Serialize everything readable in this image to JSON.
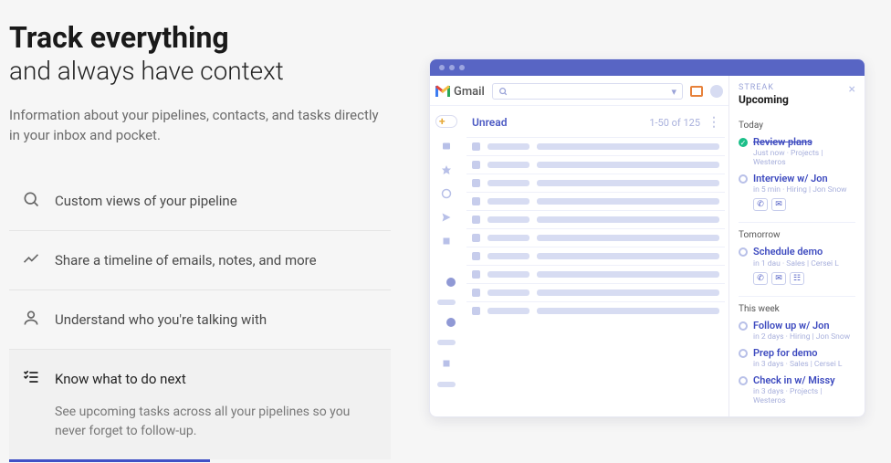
{
  "hero": {
    "title": "Track everything",
    "subtitle": "and always have context",
    "lead": "Information about your pipelines, contacts, and tasks directly in your inbox and pocket."
  },
  "features": [
    {
      "label": "Custom views of your pipeline"
    },
    {
      "label": "Share a timeline of emails, notes, and more"
    },
    {
      "label": "Understand who you're talking with"
    },
    {
      "label": "Know what to do next",
      "desc": "See upcoming tasks across all your pipelines so you never forget to follow-up."
    }
  ],
  "gmail": {
    "brand": "Gmail",
    "inbox_label": "Unread",
    "count": "1-50 of 125"
  },
  "streak": {
    "brand": "STREAK",
    "title": "Upcoming",
    "sections": [
      {
        "label": "Today",
        "tasks": [
          {
            "title": "Review plans",
            "meta": "Just now · Projects | Westeros",
            "done": true
          },
          {
            "title": "Interview w/ Jon",
            "meta": "in 5 min · Hiring | Jon Snow",
            "actions": [
              "phone",
              "mail"
            ]
          }
        ]
      },
      {
        "label": "Tomorrow",
        "tasks": [
          {
            "title": "Schedule demo",
            "meta": "in 1 dau · Sales | Cersei L",
            "actions": [
              "phone",
              "mail",
              "calendar"
            ]
          }
        ]
      },
      {
        "label": "This week",
        "tasks": [
          {
            "title": "Follow up w/ Jon",
            "meta": "in 2 days · Hiring | Jon Snow"
          },
          {
            "title": "Prep for demo",
            "meta": "in 3 days · Sales | Cersei L"
          },
          {
            "title": "Check in w/ Missy",
            "meta": "in 3 days · Projects | Westeros"
          }
        ]
      }
    ]
  }
}
